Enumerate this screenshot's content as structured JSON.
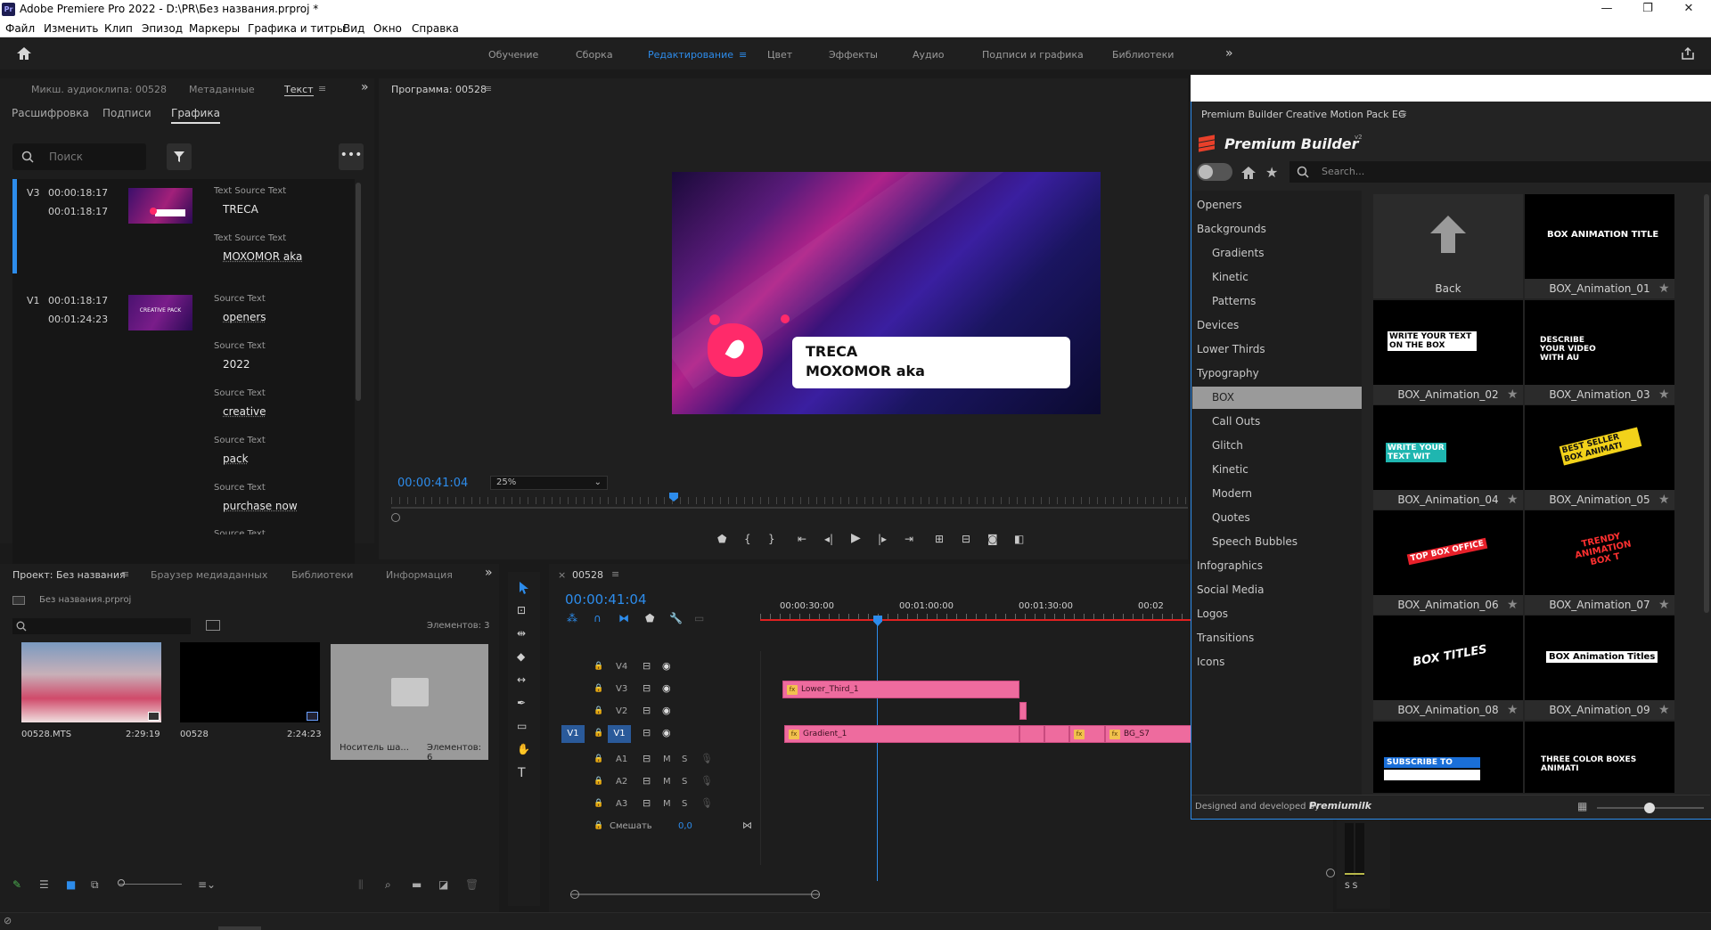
{
  "app": {
    "title": "Adobe Premiere Pro 2022 - D:\\PR\\Без названия.prproj *",
    "logo": "Pr"
  },
  "menu": [
    "Файл",
    "Изменить",
    "Клип",
    "Эпизод",
    "Маркеры",
    "Графика и титры",
    "Вид",
    "Окно",
    "Справка"
  ],
  "workspaces": [
    "Обучение",
    "Сборка",
    "Редактирование",
    "Цвет",
    "Эффекты",
    "Аудио",
    "Подписи и графика",
    "Библиотеки"
  ],
  "active_workspace": "Редактирование",
  "text_panel": {
    "tabs": [
      "Микш. аудиоклипа: 00528",
      "Метаданные",
      "Текст"
    ],
    "subtabs": [
      "Расшифровка",
      "Подписи",
      "Графика"
    ],
    "search_placeholder": "Поиск",
    "items": [
      {
        "track": "V3",
        "in": "00:00:18:17",
        "out": "00:01:18:17",
        "fields": [
          {
            "label": "Text Source Text",
            "value": "TRECA"
          },
          {
            "label": "Text Source Text",
            "value": "MOXOMOR aka"
          }
        ]
      },
      {
        "track": "V1",
        "in": "00:01:18:17",
        "out": "00:01:24:23",
        "fields": [
          {
            "label": "Source Text",
            "value": "openers"
          },
          {
            "label": "Source Text",
            "value": "2022"
          },
          {
            "label": "Source Text",
            "value": "creative"
          },
          {
            "label": "Source Text",
            "value": "pack"
          },
          {
            "label": "Source Text",
            "value": "purchase now"
          },
          {
            "label": "Source Text",
            "value": ""
          }
        ]
      }
    ],
    "thumb2_text": "CREATIVE PACK"
  },
  "program": {
    "tab": "Программа: 00528",
    "timecode": "00:00:41:04",
    "zoom": "25%",
    "preview_line1": "TRECA",
    "preview_line2": "MOXOMOR aka"
  },
  "project": {
    "tabs": [
      "Проект: Без названия",
      "Браузер медиаданных",
      "Библиотеки",
      "Информация"
    ],
    "file": "Без названия.prproj",
    "count": "Элементов: 3",
    "items": [
      {
        "name": "00528.MTS",
        "duration": "2:29:19"
      },
      {
        "name": "00528",
        "duration": "2:24:23"
      },
      {
        "name": "Носитель ша...",
        "duration": "Элементов: 6"
      }
    ]
  },
  "timeline": {
    "tab": "00528",
    "timecode": "00:00:41:04",
    "ruler": [
      "00:00:30:00",
      "00:01:00:00",
      "00:01:30:00",
      "00:02"
    ],
    "video_tracks": [
      "V4",
      "V3",
      "V2",
      "V1"
    ],
    "audio_tracks": [
      "A1",
      "A2",
      "A3"
    ],
    "mix_label": "Смешать",
    "mix_value": "0,0",
    "clips": [
      "Lower_Third_1",
      "Gradient_1",
      "BG_S7"
    ],
    "src_patch": "V1",
    "ms": "M",
    "s": "S",
    "fx": "fx",
    "meter_ss": "S S"
  },
  "premium_builder": {
    "panel_title": "Premium Builder Creative Motion Pack EG",
    "brand": "Premium Builder",
    "brand_sup": "v2",
    "search_placeholder": "Search...",
    "categories": [
      {
        "label": "Openers",
        "sub": false
      },
      {
        "label": "Backgrounds",
        "sub": false
      },
      {
        "label": "Gradients",
        "sub": true
      },
      {
        "label": "Kinetic",
        "sub": true
      },
      {
        "label": "Patterns",
        "sub": true
      },
      {
        "label": "Devices",
        "sub": false
      },
      {
        "label": "Lower Thirds",
        "sub": false
      },
      {
        "label": "Typography",
        "sub": false
      },
      {
        "label": "BOX",
        "sub": true,
        "selected": true
      },
      {
        "label": "Call Outs",
        "sub": true
      },
      {
        "label": "Glitch",
        "sub": true
      },
      {
        "label": "Kinetic",
        "sub": true
      },
      {
        "label": "Modern",
        "sub": true
      },
      {
        "label": "Quotes",
        "sub": true
      },
      {
        "label": "Speech Bubbles",
        "sub": true
      },
      {
        "label": "Infographics",
        "sub": false
      },
      {
        "label": "Social Media",
        "sub": false
      },
      {
        "label": "Logos",
        "sub": false
      },
      {
        "label": "Transitions",
        "sub": false
      },
      {
        "label": "Icons",
        "sub": false
      }
    ],
    "tiles": [
      {
        "caption": "Back",
        "art": ""
      },
      {
        "caption": "BOX_Animation_01",
        "art": "BOX ANIMATION TITLE"
      },
      {
        "caption": "BOX_Animation_02",
        "art": "WRITE YOUR TEXT ON THE BOX"
      },
      {
        "caption": "BOX_Animation_03",
        "art": "DESCRIBE YOUR VIDEO WITH AU"
      },
      {
        "caption": "BOX_Animation_04",
        "art": "WRITE YOUR TEXT WIT"
      },
      {
        "caption": "BOX_Animation_05",
        "art": "BEST SELLER BOX ANIMATI"
      },
      {
        "caption": "BOX_Animation_06",
        "art": "TOP BOX OFFICE"
      },
      {
        "caption": "BOX_Animation_07",
        "art": "TRENDY ANIMATION BOX T"
      },
      {
        "caption": "BOX_Animation_08",
        "art": "BOX TITLES"
      },
      {
        "caption": "BOX_Animation_09",
        "art": "BOX Animation Titles"
      },
      {
        "caption": "",
        "art": "SUBSCRIBE TO"
      },
      {
        "caption": "",
        "art": "THREE COLOR BOXES ANIMATI"
      }
    ],
    "footer": "Designed and developed by",
    "footer_brand": "Premiumilk"
  }
}
